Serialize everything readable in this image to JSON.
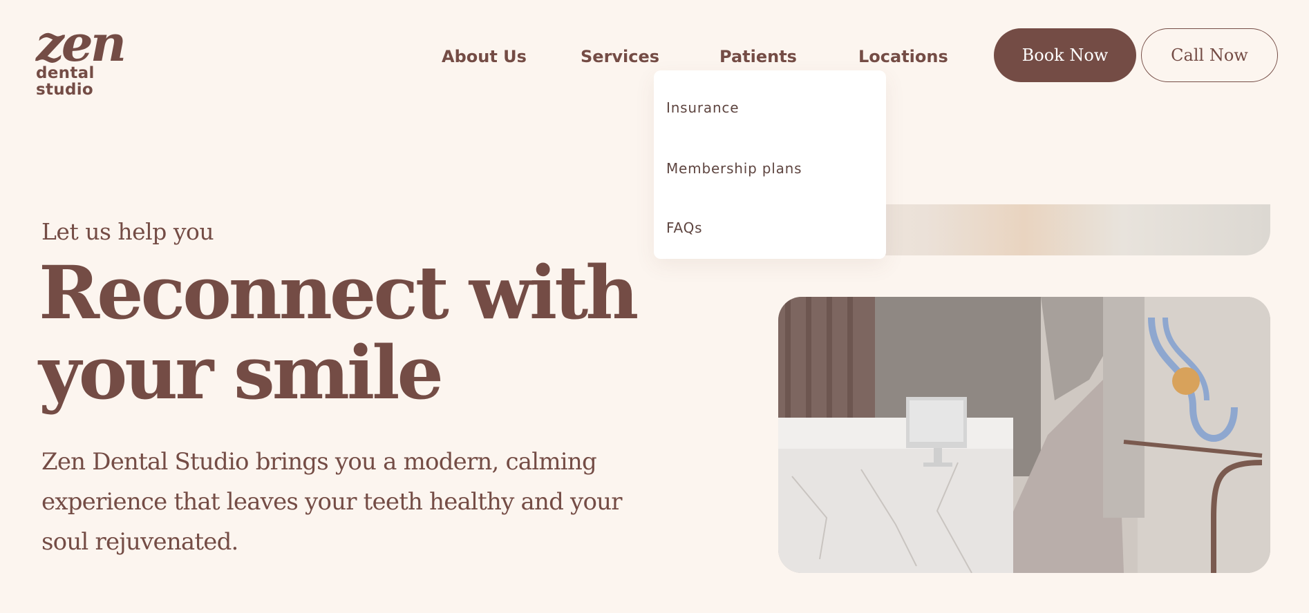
{
  "brand": {
    "logo_mark": "zen",
    "logo_sub": "dental studio"
  },
  "nav": {
    "items": [
      {
        "label": "About Us"
      },
      {
        "label": "Services"
      },
      {
        "label": "Patients"
      },
      {
        "label": "Locations"
      }
    ],
    "book_label": "Book Now",
    "call_label": "Call Now"
  },
  "dropdown": {
    "items": [
      {
        "label": "Insurance"
      },
      {
        "label": "Membership plans"
      },
      {
        "label": "FAQs"
      }
    ]
  },
  "hero": {
    "eyebrow": "Let us help you",
    "headline_line1": "Reconnect with",
    "headline_line2": "your smile",
    "lead": "Zen Dental Studio brings you a modern, calming experience that leaves your teeth healthy and your soul rejuvenated."
  },
  "colors": {
    "background": "#fcf5ef",
    "brand": "#744c45",
    "button_text": "#ffffff",
    "dropdown_bg": "#ffffff"
  }
}
